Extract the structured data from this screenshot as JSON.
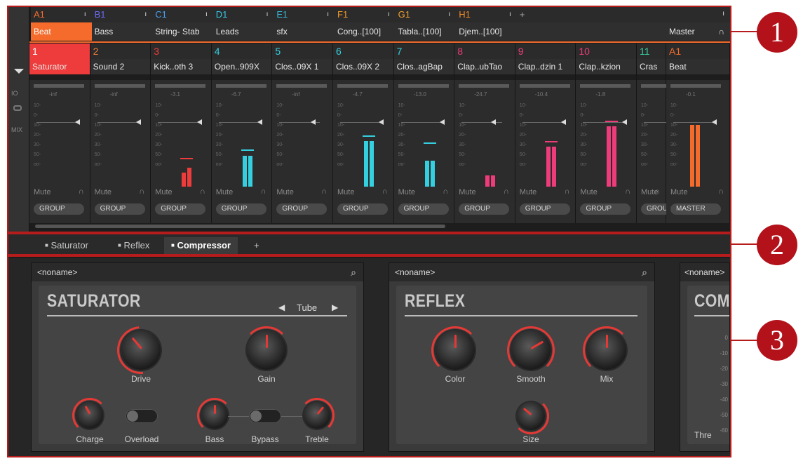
{
  "groups": [
    {
      "id": "A1",
      "name": "Beat",
      "color": "#f46b2c",
      "active": true
    },
    {
      "id": "B1",
      "name": "Bass",
      "color": "#6a6af4"
    },
    {
      "id": "C1",
      "name": "String- Stab",
      "color": "#4aa0f0"
    },
    {
      "id": "D1",
      "name": "Leads",
      "color": "#35c9e8"
    },
    {
      "id": "E1",
      "name": "sfx",
      "color": "#35b8d8"
    },
    {
      "id": "F1",
      "name": "Cong..[100]",
      "color": "#f09a2a"
    },
    {
      "id": "G1",
      "name": "Tabla..[100]",
      "color": "#f0a030"
    },
    {
      "id": "H1",
      "name": "Djem..[100]",
      "color": "#f08a2a"
    }
  ],
  "add_group": "+",
  "master_label": "Master",
  "side_labels": {
    "io": "IO",
    "mix": "MIX"
  },
  "sounds": [
    {
      "num": "1",
      "name": "Saturator",
      "color": "#ee3b3b",
      "db": "-inf",
      "meter": [
        0,
        0
      ],
      "peak": null,
      "fader": 0.82
    },
    {
      "num": "2",
      "name": "Sound 2",
      "color": "#f07a3a",
      "db": "-inf",
      "meter": [
        0,
        0
      ],
      "peak": null,
      "fader": 0.82
    },
    {
      "num": "3",
      "name": "Kick..oth 3",
      "color": "#ee3b3b",
      "db": "-3.1",
      "meter": [
        0.2,
        0.28
      ],
      "peak": 0.42,
      "fader": 0.82
    },
    {
      "num": "4",
      "name": "Open..909X",
      "color": "#35d0e0",
      "db": "-6.7",
      "meter": [
        0.45,
        0.45
      ],
      "peak": 0.54,
      "fader": 0.82
    },
    {
      "num": "5",
      "name": "Clos..09X 1",
      "color": "#35d0e0",
      "db": "-inf",
      "meter": [
        0,
        0
      ],
      "peak": null,
      "fader": 0.66
    },
    {
      "num": "6",
      "name": "Clos..09X 2",
      "color": "#35d0e0",
      "db": "-4.7",
      "meter": [
        0.66,
        0.66
      ],
      "peak": 0.74,
      "fader": 0.82
    },
    {
      "num": "7",
      "name": "Clos..agBap",
      "color": "#35d0e0",
      "db": "-13.0",
      "meter": [
        0.38,
        0.38
      ],
      "peak": 0.64,
      "fader": 0.82
    },
    {
      "num": "8",
      "name": "Clap..ubTao",
      "color": "#ee3b7a",
      "db": "-24.7",
      "meter": [
        0.16,
        0.16
      ],
      "peak": null,
      "fader": 0.62
    },
    {
      "num": "9",
      "name": "Clap..dzin 1",
      "color": "#ee3b7a",
      "db": "-10.4",
      "meter": [
        0.58,
        0.58
      ],
      "peak": 0.66,
      "fader": 0.82
    },
    {
      "num": "10",
      "name": "Clap..kzion",
      "color": "#ee3b7a",
      "db": "-1.8",
      "meter": [
        0.88,
        0.88
      ],
      "peak": 0.96,
      "fader": 0.82
    },
    {
      "num": "11",
      "name": "Cras",
      "color": "#35d0a0",
      "db": "",
      "meter": [
        0,
        0
      ],
      "peak": null,
      "fader": 0.82
    }
  ],
  "master_sound": {
    "num": "A1",
    "name": "Beat",
    "color": "#f46b2c",
    "db": "-0.1",
    "meter": [
      0.9,
      0.9
    ],
    "fader": 0.82,
    "button": "MASTER"
  },
  "strip_labels": {
    "mute": "Mute",
    "group_button": "GROUP",
    "headphone": "🎧"
  },
  "tabs": [
    {
      "label": "Saturator",
      "active": false
    },
    {
      "label": "Reflex",
      "active": false
    },
    {
      "label": "Compressor",
      "active": true
    }
  ],
  "tab_add": "+",
  "devices": {
    "saturator": {
      "preset": "<noname>",
      "title": "SATURATOR",
      "mode": "Tube",
      "knobs": {
        "drive": "Drive",
        "gain": "Gain",
        "charge": "Charge",
        "bass": "Bass",
        "treble": "Treble"
      },
      "toggles": {
        "overload": "Overload",
        "bypass": "Bypass"
      }
    },
    "reflex": {
      "preset": "<noname>",
      "title": "REFLEX",
      "knobs": {
        "color": "Color",
        "smooth": "Smooth",
        "mix": "Mix",
        "size": "Size"
      }
    },
    "compressor": {
      "preset": "<noname>",
      "title": "COM",
      "label": "Thre",
      "scale": [
        "0",
        "-10",
        "-20",
        "-30",
        "-40",
        "-50",
        "-60"
      ]
    }
  },
  "callouts": [
    "1",
    "2",
    "3"
  ],
  "colors": {
    "accent": "#e53935",
    "callout": "#b3121b",
    "knob_arc": "#e53935"
  }
}
